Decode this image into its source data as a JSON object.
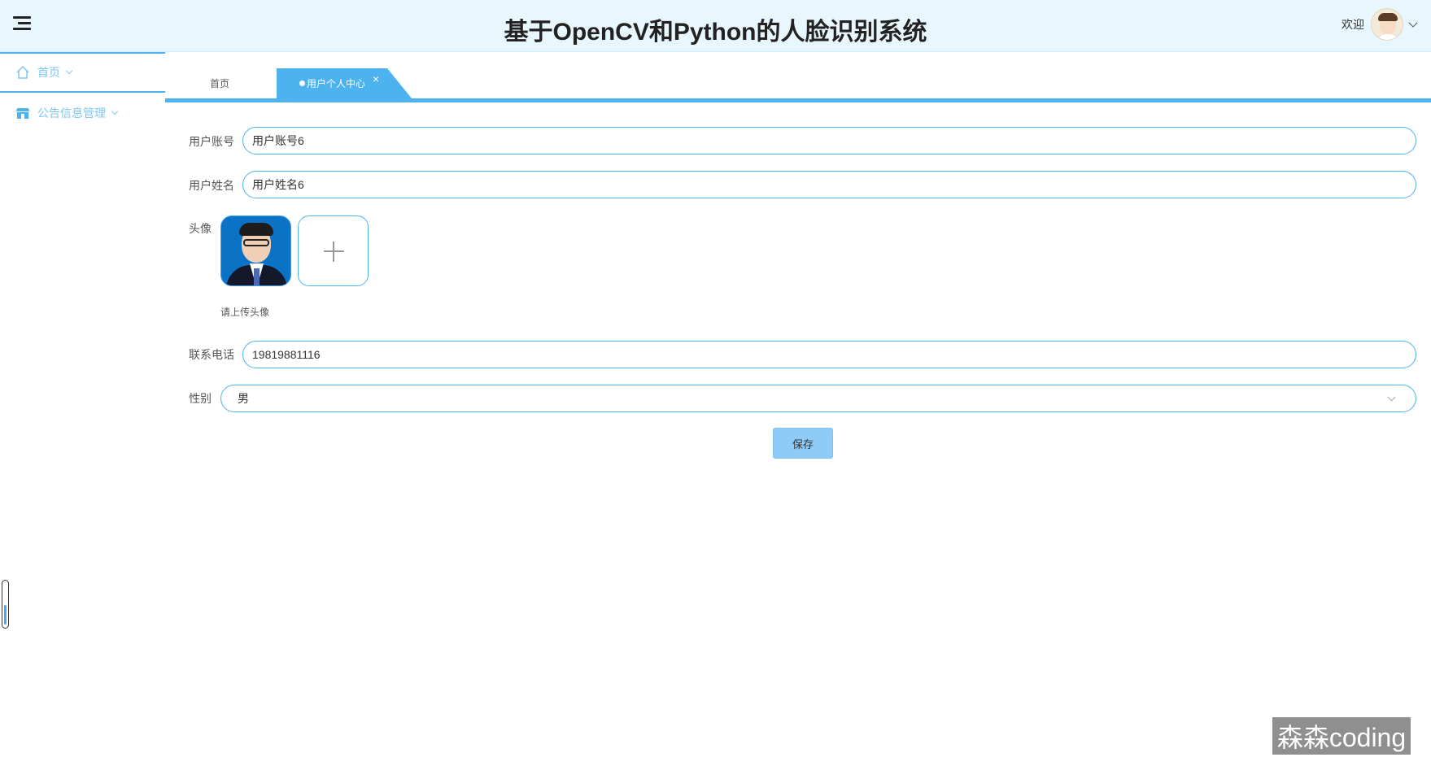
{
  "header": {
    "title": "基于OpenCV和Python的人脸识别系统",
    "welcome": "欢迎"
  },
  "sidebar": {
    "items": [
      {
        "label": "首页",
        "icon": "home-icon"
      },
      {
        "label": "公告信息管理",
        "icon": "store-icon"
      }
    ]
  },
  "tabs": {
    "home": "首页",
    "active": "用户个人中心",
    "close": "×"
  },
  "form": {
    "account": {
      "label": "用户账号",
      "value": "用户账号6"
    },
    "name": {
      "label": "用户姓名",
      "value": "用户姓名6"
    },
    "avatar": {
      "label": "头像",
      "hint": "请上传头像"
    },
    "phone": {
      "label": "联系电话",
      "value": "19819881116"
    },
    "gender": {
      "label": "性别",
      "value": "男"
    },
    "save_label": "保存"
  },
  "watermark": "森森coding",
  "colors": {
    "accent": "#4db3ef",
    "header_bg": "#e8f6fd",
    "save_button": "#8ecbf6"
  }
}
